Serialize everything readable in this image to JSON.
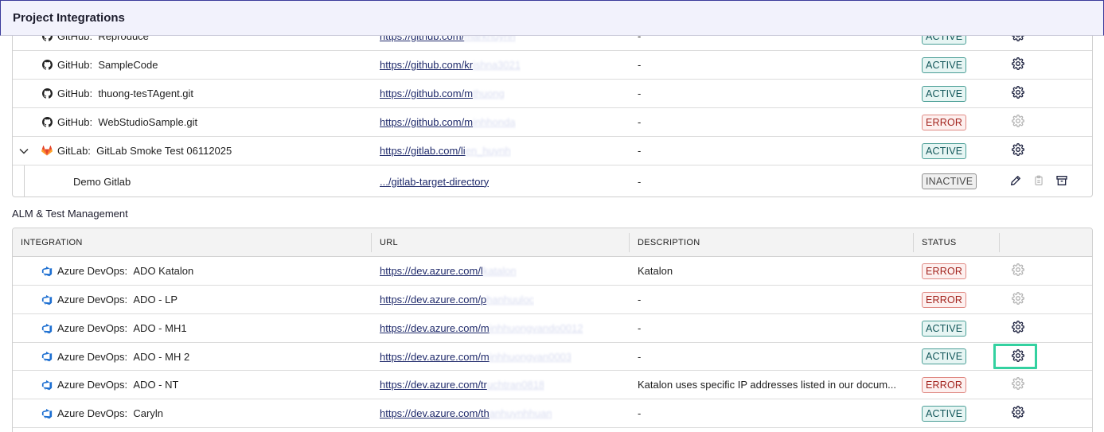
{
  "header": {
    "title": "Project Integrations"
  },
  "vcs_rows": [
    {
      "provider": "GitHub:",
      "name": "Reproduce",
      "url": "https://github.com/",
      "url_blur": "markhuynh",
      "description": "-",
      "status": "ACTIVE",
      "action": "gear"
    },
    {
      "provider": "GitHub:",
      "name": "SampleCode",
      "url": "https://github.com/kr",
      "url_blur": "ishna3021",
      "description": "-",
      "status": "ACTIVE",
      "action": "gear"
    },
    {
      "provider": "GitHub:",
      "name": "thuong-tesTAgent.git",
      "url": "https://github.com/m",
      "url_blur": "thuong",
      "description": "-",
      "status": "ACTIVE",
      "action": "gear"
    },
    {
      "provider": "GitHub:",
      "name": "WebStudioSample.git",
      "url": "https://github.com/m",
      "url_blur": "inhhonda",
      "description": "-",
      "status": "ERROR",
      "action": "gear-disabled"
    },
    {
      "provider": "GitLab:",
      "name": "GitLab Smoke Test 06112025",
      "url": "https://gitlab.com/li",
      "url_blur": "en_huynh",
      "description": "-",
      "status": "ACTIVE",
      "action": "gear"
    }
  ],
  "child_row": {
    "name": "Demo Gitlab",
    "url": ".../gitlab-target-directory",
    "description": "-",
    "status": "INACTIVE"
  },
  "alm_section": {
    "label": "ALM & Test Management"
  },
  "alm_headers": {
    "integration": "INTEGRATION",
    "url": "URL",
    "description": "DESCRIPTION",
    "status": "STATUS"
  },
  "alm_rows": [
    {
      "provider": "Azure DevOps:",
      "name": "ADO Katalon",
      "url": "https://dev.azure.com/l",
      "url_blur": "katalon",
      "description": "Katalon",
      "status": "ERROR",
      "action": "gear-disabled"
    },
    {
      "provider": "Azure DevOps:",
      "name": "ADO - LP",
      "url": "https://dev.azure.com/p",
      "url_blur": "hanhuuloc",
      "description": "-",
      "status": "ERROR",
      "action": "gear-disabled"
    },
    {
      "provider": "Azure DevOps:",
      "name": "ADO - MH1",
      "url": "https://dev.azure.com/m",
      "url_blur": "inhhuongvando0012",
      "description": "-",
      "status": "ACTIVE",
      "action": "gear"
    },
    {
      "provider": "Azure DevOps:",
      "name": "ADO - MH 2",
      "url": "https://dev.azure.com/m",
      "url_blur": "inhhuongvan0003",
      "description": "-",
      "status": "ACTIVE",
      "action": "gear"
    },
    {
      "provider": "Azure DevOps:",
      "name": "ADO - NT",
      "url": "https://dev.azure.com/tr",
      "url_blur": "uchtran0818",
      "description": "Katalon uses specific IP addresses listed in our docum...",
      "status": "ERROR",
      "action": "gear-disabled"
    },
    {
      "provider": "Azure DevOps:",
      "name": "Caryln",
      "url": "https://dev.azure.com/th",
      "url_blur": "anhuynhhuan",
      "description": "-",
      "status": "ACTIVE",
      "action": "gear"
    }
  ],
  "colors": {
    "accent_highlight": "#33d1a0",
    "active": "#13575a",
    "error": "#a2231d"
  }
}
